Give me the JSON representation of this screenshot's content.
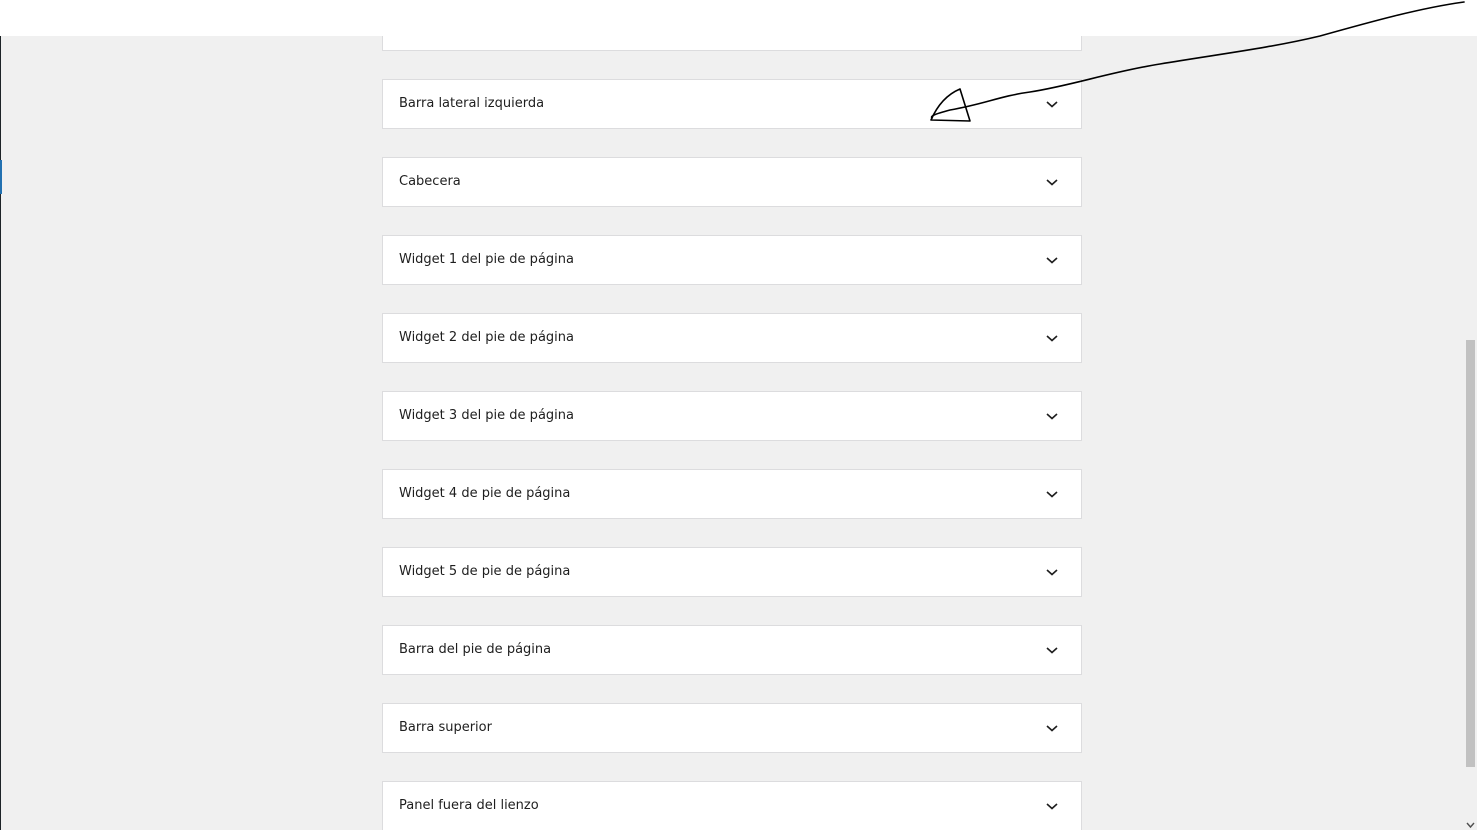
{
  "panels": [
    {
      "label": ""
    },
    {
      "label": "Barra lateral izquierda"
    },
    {
      "label": "Cabecera"
    },
    {
      "label": "Widget 1 del pie de página"
    },
    {
      "label": "Widget 2 del pie de página"
    },
    {
      "label": "Widget 3 del pie de página"
    },
    {
      "label": "Widget 4 de pie de página"
    },
    {
      "label": "Widget 5 de pie de página"
    },
    {
      "label": "Barra del pie de página"
    },
    {
      "label": "Barra superior"
    },
    {
      "label": "Panel fuera del lienzo"
    }
  ],
  "icons": {
    "expand": "chevron-down-icon"
  },
  "colors": {
    "background": "#f0f0f0",
    "panel": "#ffffff",
    "panel_border": "#dcdcde",
    "accent": "#2271b1",
    "scrollbar_thumb": "#c1c1c1"
  }
}
